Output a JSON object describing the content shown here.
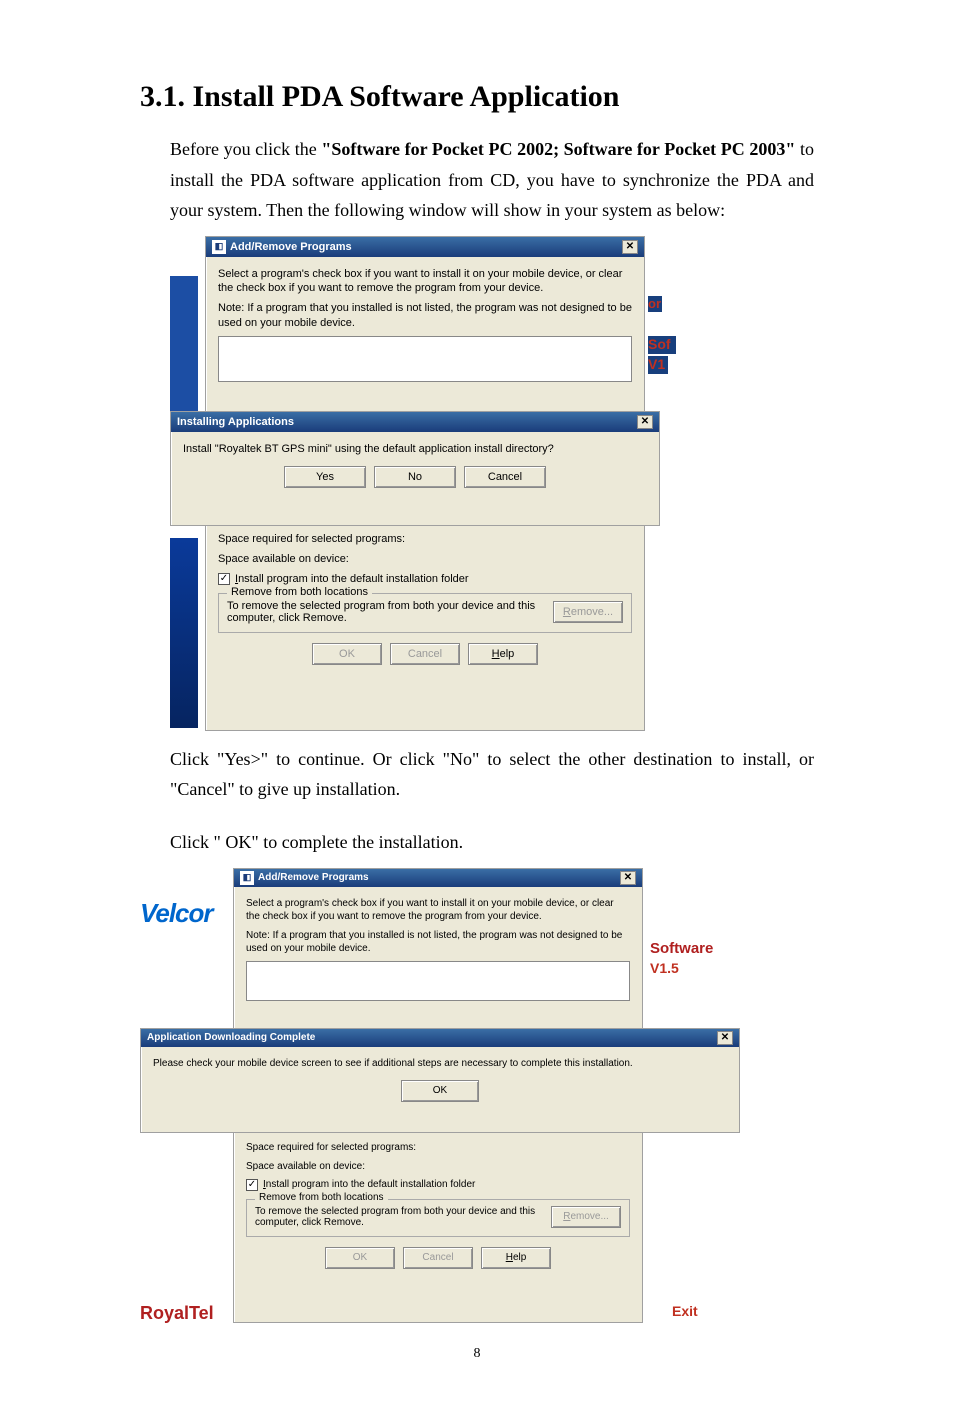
{
  "heading": "3.1. Install PDA Software Application",
  "intro_before_bold": "Before you click the ",
  "intro_bold": "\"Software for Pocket PC 2002; Software for Pocket PC 2003\"",
  "intro_after_bold": " to install the PDA software application from CD, you have to synchronize the PDA and your system. Then the following window will show in your system as below:",
  "para2": "Click \"Yes>\" to continue. Or click \"No\" to select the other destination to install, or \"Cancel\" to give up installation.",
  "para3": "Click \" OK\" to complete the installation.",
  "page_number": "8",
  "add_remove": {
    "title": "Add/Remove Programs",
    "desc1": "Select a program's check box if you want to install it on your mobile device, or clear the check box if you want to remove the program from your device.",
    "desc2": "Note:  If a program that you installed is not listed, the program was not designed to be used on your mobile device.",
    "space_req": "Space required for selected programs:",
    "space_avail": "Space available on device:",
    "install_default": "Install program into the default installation folder",
    "remove_group": "Remove from both locations",
    "remove_text": "To remove the selected program from both your device and this computer, click Remove.",
    "btn_remove": "Remove...",
    "btn_ok": "OK",
    "btn_cancel": "Cancel",
    "btn_help": "Help"
  },
  "installing": {
    "title": "Installing Applications",
    "question": "Install \"Royaltek BT GPS mini\" using the default application install directory?",
    "yes": "Yes",
    "no": "No",
    "cancel": "Cancel"
  },
  "download_complete": {
    "title": "Application Downloading Complete",
    "msg": "Please check your mobile device screen to see if additional steps are necessary to complete this installation.",
    "ok": "OK"
  },
  "bg": {
    "velcor": "Velcor",
    "software": "Software",
    "v15": "V1.5",
    "royaltel": "RoyalTel",
    "exit": "Exit",
    "sof": "Sof",
    "v1": "V1",
    "or": "or"
  }
}
